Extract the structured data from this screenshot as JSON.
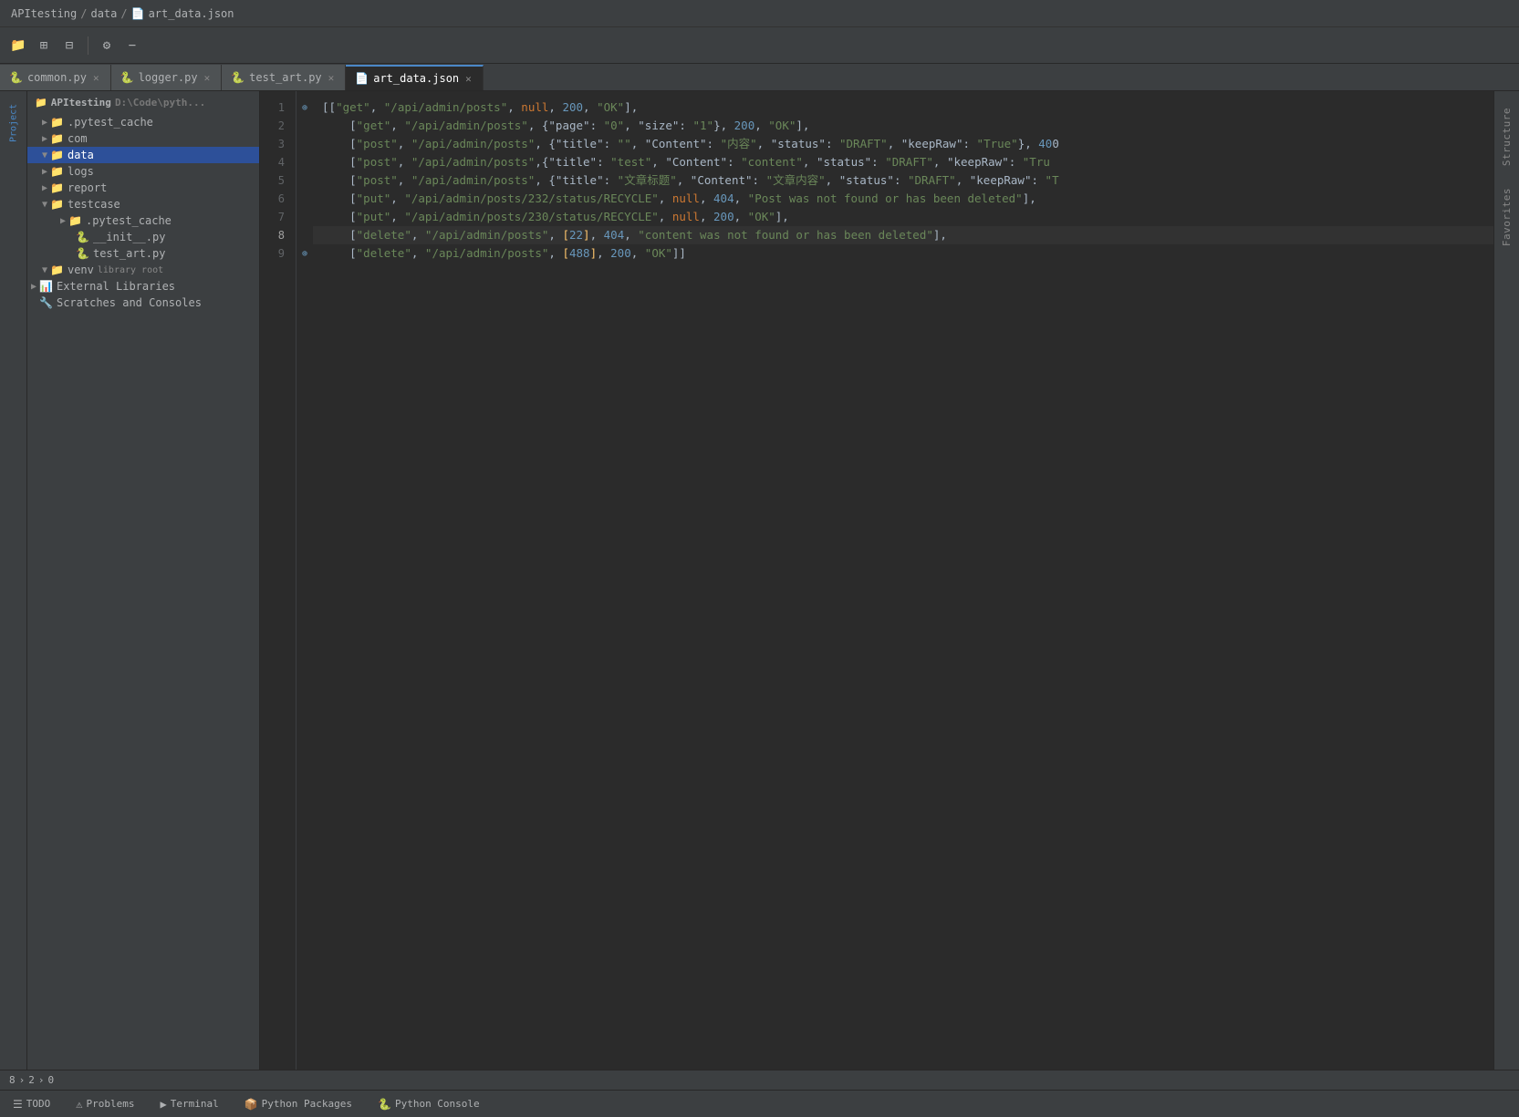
{
  "breadcrumb": {
    "project": "APItesting",
    "sep1": "/",
    "data": "data",
    "sep2": "/",
    "file_icon": "📄",
    "file": "art_data.json"
  },
  "toolbar": {
    "icons": [
      {
        "name": "project-icon",
        "symbol": "📁"
      },
      {
        "name": "expand-icon",
        "symbol": "⊞"
      },
      {
        "name": "collapse-icon",
        "symbol": "⊟"
      },
      {
        "name": "settings-icon",
        "symbol": "⚙"
      },
      {
        "name": "minus-icon",
        "symbol": "−"
      }
    ]
  },
  "tabs": [
    {
      "id": "common",
      "label": "common.py",
      "icon": "🐍",
      "active": false
    },
    {
      "id": "logger",
      "label": "logger.py",
      "icon": "🐍",
      "active": false
    },
    {
      "id": "test_art",
      "label": "test_art.py",
      "icon": "🐍",
      "active": false
    },
    {
      "id": "art_data",
      "label": "art_data.json",
      "icon": "📄",
      "active": true
    }
  ],
  "sidebar": {
    "project_name": "APItesting",
    "project_path": "D:\\Code\\pyth...",
    "items": [
      {
        "id": "pytest_cache",
        "label": ".pytest_cache",
        "type": "folder",
        "level": 1,
        "expanded": false
      },
      {
        "id": "com",
        "label": "com",
        "type": "folder",
        "level": 1,
        "expanded": false
      },
      {
        "id": "data",
        "label": "data",
        "type": "folder",
        "level": 1,
        "expanded": true,
        "selected": true
      },
      {
        "id": "logs",
        "label": "logs",
        "type": "folder",
        "level": 1,
        "expanded": false
      },
      {
        "id": "report",
        "label": "report",
        "type": "folder",
        "level": 1,
        "expanded": false
      },
      {
        "id": "testcase",
        "label": "testcase",
        "type": "folder",
        "level": 1,
        "expanded": true
      },
      {
        "id": "pytest_cache2",
        "label": ".pytest_cache",
        "type": "folder",
        "level": 2,
        "expanded": false
      },
      {
        "id": "init_py",
        "label": "__init__.py",
        "type": "python",
        "level": 2
      },
      {
        "id": "test_art_py",
        "label": "test_art.py",
        "type": "python",
        "level": 2
      },
      {
        "id": "venv",
        "label": "venv",
        "type": "folder",
        "level": 1,
        "expanded": true,
        "badge": "library root"
      },
      {
        "id": "external_libs",
        "label": "External Libraries",
        "type": "folder",
        "level": 0,
        "expanded": false
      },
      {
        "id": "scratches",
        "label": "Scratches and Consoles",
        "type": "scratches",
        "level": 0
      }
    ]
  },
  "code": {
    "lines": [
      {
        "num": 1,
        "has_gutter": true,
        "gutter_sym": "⊕",
        "content": "[[\"get\", \"/api/admin/posts\", null, 200, \"OK\"],"
      },
      {
        "num": 2,
        "content": "    [\"get\", \"/api/admin/posts\", {\"page\": \"0\", \"size\": \"1\"}, 200, \"OK\"],"
      },
      {
        "num": 3,
        "content": "    [\"post\", \"/api/admin/posts\", {\"title\": \"\", \"Content\": \"内容\", \"status\": \"DRAFT\", \"keepRaw\": \"True\"}, 400"
      },
      {
        "num": 4,
        "content": "    [\"post\", \"/api/admin/posts\",{\"title\": \"test\", \"Content\": \"content\", \"status\": \"DRAFT\", \"keepRaw\": \"Tru"
      },
      {
        "num": 5,
        "content": "    [\"post\", \"/api/admin/posts\", {\"title\": \"文章标题\", \"Content\": \"文章内容\", \"status\": \"DRAFT\", \"keepRaw\": \"T"
      },
      {
        "num": 6,
        "content": "    [\"put\", \"/api/admin/posts/232/status/RECYCLE\", null, 404, \"Post was not found or has been deleted\"],"
      },
      {
        "num": 7,
        "content": "    [\"put\", \"/api/admin/posts/230/status/RECYCLE\", null, 200, \"OK\"],"
      },
      {
        "num": 8,
        "content": "    [\"delete\", \"/api/admin/posts\", [22], 404, \"content was not found or has been deleted\"],"
      },
      {
        "num": 9,
        "has_gutter": true,
        "gutter_sym": "⊕",
        "content": "    [\"delete\", \"/api/admin/posts\", [488], 200, \"OK\"]]"
      }
    ]
  },
  "status_bar": {
    "line": "8",
    "col": "2",
    "offset": "0"
  },
  "bottom_tabs": [
    {
      "id": "todo",
      "label": "TODO",
      "icon": "☰"
    },
    {
      "id": "problems",
      "label": "Problems",
      "icon": "⚠"
    },
    {
      "id": "terminal",
      "label": "Terminal",
      "icon": "▶"
    },
    {
      "id": "python_packages",
      "label": "Python Packages",
      "icon": "📦"
    },
    {
      "id": "python_console",
      "label": "Python Console",
      "icon": "🐍"
    }
  ],
  "right_tabs": [
    {
      "id": "structure",
      "label": "Structure"
    },
    {
      "id": "favorites",
      "label": "Favorites"
    }
  ],
  "colors": {
    "bg": "#2b2b2b",
    "sidebar_bg": "#3c3f41",
    "active_tab_border": "#4a88c7",
    "selected_tree": "#2d5099"
  }
}
